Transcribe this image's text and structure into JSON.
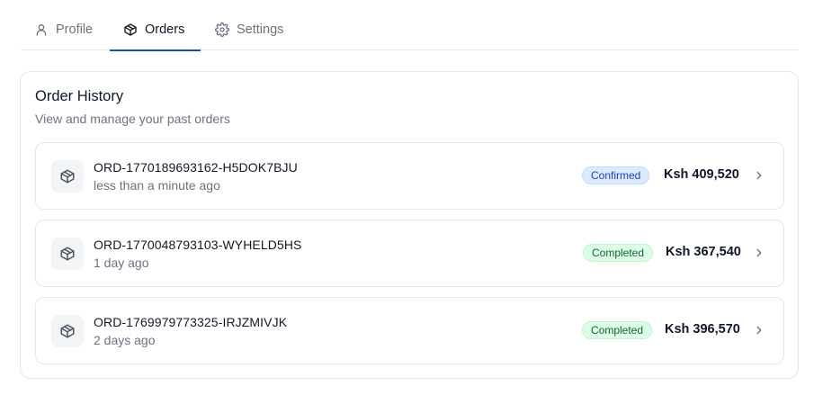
{
  "tabs": [
    {
      "label": "Profile",
      "icon": "user-icon",
      "active": false
    },
    {
      "label": "Orders",
      "icon": "package-icon",
      "active": true
    },
    {
      "label": "Settings",
      "icon": "gear-icon",
      "active": false
    }
  ],
  "card": {
    "title": "Order History",
    "subtitle": "View and manage your past orders"
  },
  "orders": [
    {
      "id": "ORD-1770189693162-H5DOK7BJU",
      "time": "less than a minute ago",
      "status": "Confirmed",
      "amount": "Ksh 409,520"
    },
    {
      "id": "ORD-1770048793103-WYHELD5HS",
      "time": "1 day ago",
      "status": "Completed",
      "amount": "Ksh 367,540"
    },
    {
      "id": "ORD-1769979773325-IRJZMIVJK",
      "time": "2 days ago",
      "status": "Completed",
      "amount": "Ksh 396,570"
    }
  ],
  "colors": {
    "accent": "#1e4fa3",
    "confirmed_bg": "#dbeafe",
    "confirmed_text": "#1e40af",
    "completed_bg": "#dcfce7",
    "completed_text": "#166534"
  }
}
